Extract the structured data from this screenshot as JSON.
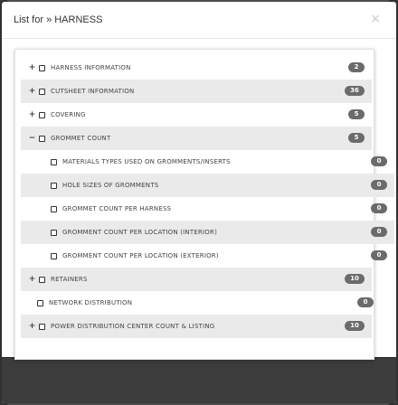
{
  "modal": {
    "title": "List for » HARNESS",
    "close_glyph": "×"
  },
  "tree": [
    {
      "label": "HARNESS INFORMATION",
      "toggle": "+",
      "count": "2",
      "level": 0,
      "shaded": false
    },
    {
      "label": "CUTSHEET INFORMATION",
      "toggle": "+",
      "count": "36",
      "level": 0,
      "shaded": true
    },
    {
      "label": "COVERING",
      "toggle": "+",
      "count": "5",
      "level": 0,
      "shaded": false
    },
    {
      "label": "GROMMET COUNT",
      "toggle": "−",
      "count": "5",
      "level": 0,
      "shaded": true
    },
    {
      "label": "MATERIALS TYPES USED ON GROMMENTS/INSERTS",
      "toggle": "",
      "count": "0",
      "level": 1,
      "shaded": false
    },
    {
      "label": "HOLE SIZES OF GROMMENTS",
      "toggle": "",
      "count": "0",
      "level": 1,
      "shaded": true
    },
    {
      "label": "GROMMET COUNT PER HARNESS",
      "toggle": "",
      "count": "0",
      "level": 1,
      "shaded": false
    },
    {
      "label": "GROMMENT COUNT PER LOCATION (INTERIOR)",
      "toggle": "",
      "count": "0",
      "level": 1,
      "shaded": true
    },
    {
      "label": "GROMMENT COUNT PER LOCATION (EXTERIOR)",
      "toggle": "",
      "count": "0",
      "level": 1,
      "shaded": false
    },
    {
      "label": "RETAINERS",
      "toggle": "+",
      "count": "10",
      "level": 0,
      "shaded": true
    },
    {
      "label": "NETWORK DISTRIBUTION",
      "toggle": "",
      "count": "0",
      "level": 0,
      "shaded": false
    },
    {
      "label": "POWER DISTRIBUTION CENTER COUNT & LISTING",
      "toggle": "+",
      "count": "10",
      "level": 0,
      "shaded": true
    }
  ]
}
